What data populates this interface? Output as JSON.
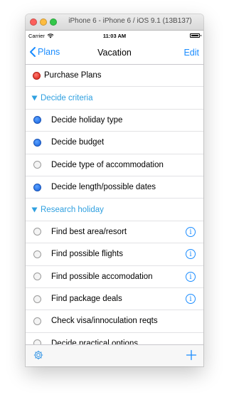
{
  "window": {
    "title": "iPhone 6 - iPhone 6 / iOS 9.1 (13B137)"
  },
  "status_bar": {
    "carrier": "Carrier",
    "time": "11:03 AM"
  },
  "nav": {
    "back_label": "Plans",
    "title": "Vacation",
    "edit_label": "Edit"
  },
  "top_item": {
    "label": "Purchase Plans",
    "status": "red"
  },
  "sections": [
    {
      "title": "Decide criteria",
      "items": [
        {
          "label": "Decide holiday type",
          "status": "blue"
        },
        {
          "label": "Decide budget",
          "status": "blue"
        },
        {
          "label": "Decide type of accommodation",
          "status": "empty"
        },
        {
          "label": "Decide length/possible dates",
          "status": "blue"
        }
      ]
    },
    {
      "title": "Research holiday",
      "items": [
        {
          "label": "Find best area/resort",
          "status": "empty",
          "info": true
        },
        {
          "label": "Find possible flights",
          "status": "empty",
          "info": true
        },
        {
          "label": "Find possible accomodation",
          "status": "empty",
          "info": true
        },
        {
          "label": "Find package deals",
          "status": "empty",
          "info": true
        },
        {
          "label": "Check visa/innoculation reqts",
          "status": "empty"
        },
        {
          "label": "Decide practical options",
          "status": "empty"
        }
      ]
    }
  ],
  "icons": {
    "info": "i",
    "settings": "gear-icon",
    "add": "plus-icon"
  },
  "colors": {
    "accent": "#1a8cff",
    "section": "#2fa0e0",
    "red_dot": "#d61d12",
    "blue_dot": "#1660dc"
  }
}
